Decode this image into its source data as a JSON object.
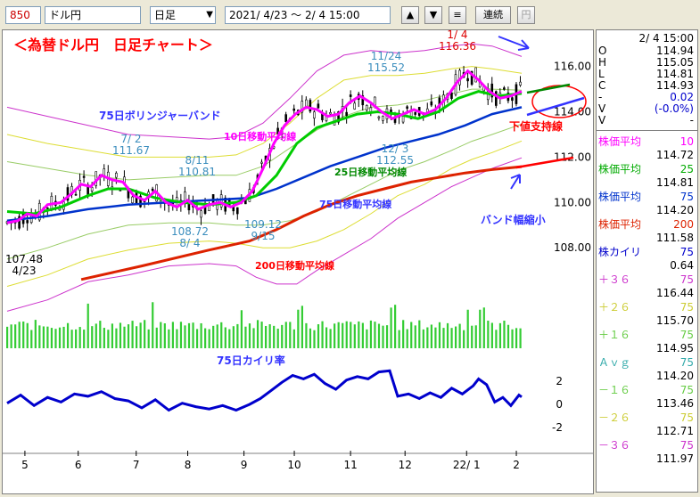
{
  "toolbar": {
    "code": "850",
    "symbol": "ドル円",
    "period": "日足",
    "dropdown_arrow": "▼",
    "range": "2021/ 4/23 〜  2/ 4 15:00",
    "up_btn": "▲",
    "down_btn": "▼",
    "menu_btn": "≡",
    "renzoku": "連続",
    "yen": "円"
  },
  "colors": {
    "candle": "#000000",
    "ma10": "#ff00ff",
    "ma25": "#00cc00",
    "ma75": "#0033cc",
    "ma200": "#dd2200",
    "bb1": "#99cc66",
    "bb2": "#dddd33",
    "bb3": "#cc33cc",
    "kairi": "#0000cc",
    "volume": "#33cc33",
    "annotation_red": "#ff0000",
    "annotation_blue": "#3333ff",
    "annotation_magenta": "#ff00ff",
    "annotation_green": "#008800"
  },
  "annotations": {
    "title": "＜為替ドル円　日足チャート＞",
    "bollinger": "75日ボリンジャーバンド",
    "ma10": "10日移動平均線",
    "ma25": "25日移動平均線",
    "ma75": "75日移動平均線",
    "ma200": "200日移動平均線",
    "support": "下値支持線",
    "band_shrink": "バンド幅縮小",
    "kairi_label": "75日カイリ率"
  },
  "chart_data": {
    "type": "line",
    "price_axis": {
      "ticks": [
        "116.00",
        "114.00",
        "112.00",
        "110.00",
        "108.00"
      ],
      "ylim": [
        106.2,
        117.4
      ]
    },
    "kairi_axis": {
      "ticks": [
        "2",
        "0",
        "-2"
      ]
    },
    "x_ticks": [
      "5",
      "6",
      "7",
      "8",
      "9",
      "10",
      "11",
      "12",
      "22/ 1",
      "2"
    ],
    "callouts": [
      {
        "date": "1/ 4",
        "value": "116.36"
      },
      {
        "date": "11/24",
        "value": "115.52"
      },
      {
        "date": "7/ 2",
        "value": "111.67"
      },
      {
        "date": "8/11",
        "value": "110.81"
      },
      {
        "date": "12/ 3",
        "value": "112.55"
      },
      {
        "date": "8/ 4",
        "value": "108.72"
      },
      {
        "date": "9/15",
        "value": "109.12"
      },
      {
        "date": "4/23",
        "value": "107.48"
      }
    ],
    "series_points": {
      "ma10": [
        [
          0,
          109.1
        ],
        [
          8,
          109.2
        ],
        [
          15,
          109.5
        ],
        [
          22,
          109.4
        ],
        [
          30,
          109.9
        ],
        [
          40,
          110.0
        ],
        [
          48,
          110.4
        ],
        [
          55,
          110.8
        ],
        [
          62,
          110.7
        ],
        [
          70,
          111.2
        ],
        [
          78,
          111.0
        ],
        [
          86,
          110.9
        ],
        [
          94,
          110.3
        ],
        [
          102,
          110.1
        ],
        [
          110,
          110.5
        ],
        [
          118,
          110.0
        ],
        [
          126,
          109.8
        ],
        [
          134,
          110.1
        ],
        [
          142,
          109.7
        ],
        [
          150,
          109.9
        ],
        [
          158,
          110.0
        ],
        [
          166,
          109.8
        ],
        [
          174,
          110.0
        ],
        [
          182,
          110.5
        ],
        [
          190,
          111.5
        ],
        [
          198,
          112.6
        ],
        [
          206,
          113.4
        ],
        [
          214,
          113.9
        ],
        [
          222,
          114.2
        ],
        [
          230,
          114.1
        ],
        [
          238,
          113.8
        ],
        [
          246,
          113.9
        ],
        [
          254,
          114.4
        ],
        [
          262,
          114.7
        ],
        [
          270,
          114.4
        ],
        [
          278,
          114.0
        ],
        [
          286,
          113.7
        ],
        [
          294,
          113.9
        ],
        [
          302,
          114.1
        ],
        [
          310,
          113.9
        ],
        [
          318,
          114.1
        ],
        [
          326,
          114.6
        ],
        [
          334,
          115.3
        ],
        [
          342,
          115.8
        ],
        [
          350,
          115.4
        ],
        [
          358,
          114.9
        ],
        [
          366,
          114.6
        ],
        [
          374,
          114.7
        ],
        [
          382,
          114.9
        ]
      ],
      "ma25": [
        [
          0,
          109.6
        ],
        [
          20,
          109.5
        ],
        [
          40,
          109.8
        ],
        [
          60,
          110.3
        ],
        [
          75,
          110.6
        ],
        [
          90,
          110.6
        ],
        [
          110,
          110.2
        ],
        [
          130,
          110.0
        ],
        [
          150,
          109.9
        ],
        [
          170,
          110.0
        ],
        [
          185,
          110.3
        ],
        [
          200,
          111.2
        ],
        [
          215,
          112.6
        ],
        [
          230,
          113.3
        ],
        [
          245,
          113.6
        ],
        [
          260,
          113.9
        ],
        [
          275,
          114.0
        ],
        [
          290,
          113.9
        ],
        [
          305,
          113.7
        ],
        [
          320,
          114.0
        ],
        [
          335,
          114.6
        ],
        [
          350,
          114.9
        ],
        [
          365,
          114.7
        ],
        [
          382,
          114.81
        ]
      ],
      "ma75": [
        [
          0,
          109.2
        ],
        [
          30,
          109.4
        ],
        [
          60,
          109.7
        ],
        [
          90,
          109.9
        ],
        [
          120,
          110.0
        ],
        [
          150,
          110.1
        ],
        [
          180,
          110.2
        ],
        [
          200,
          110.6
        ],
        [
          220,
          111.1
        ],
        [
          240,
          111.6
        ],
        [
          260,
          112.0
        ],
        [
          280,
          112.4
        ],
        [
          300,
          112.7
        ],
        [
          320,
          113.0
        ],
        [
          340,
          113.4
        ],
        [
          360,
          113.9
        ],
        [
          382,
          114.2
        ]
      ],
      "ma200": [
        [
          55,
          106.6
        ],
        [
          100,
          107.2
        ],
        [
          150,
          107.9
        ],
        [
          180,
          108.3
        ],
        [
          200,
          108.8
        ],
        [
          220,
          109.4
        ],
        [
          240,
          109.9
        ],
        [
          260,
          110.3
        ],
        [
          280,
          110.6
        ],
        [
          300,
          110.9
        ],
        [
          320,
          111.1
        ],
        [
          340,
          111.3
        ],
        [
          360,
          111.45
        ],
        [
          382,
          111.58
        ]
      ],
      "bb_plus3": [
        [
          0,
          114.2
        ],
        [
          30,
          113.8
        ],
        [
          60,
          113.4
        ],
        [
          90,
          113.0
        ],
        [
          120,
          112.9
        ],
        [
          150,
          112.8
        ],
        [
          170,
          112.9
        ],
        [
          190,
          113.5
        ],
        [
          210,
          114.6
        ],
        [
          230,
          115.8
        ],
        [
          250,
          116.5
        ],
        [
          270,
          116.7
        ],
        [
          290,
          116.6
        ],
        [
          310,
          116.7
        ],
        [
          330,
          116.9
        ],
        [
          345,
          117.0
        ],
        [
          360,
          116.9
        ],
        [
          382,
          116.44
        ]
      ],
      "bb_plus2": [
        [
          0,
          113.0
        ],
        [
          30,
          112.6
        ],
        [
          60,
          112.3
        ],
        [
          90,
          112.0
        ],
        [
          120,
          112.0
        ],
        [
          150,
          112.0
        ],
        [
          170,
          112.1
        ],
        [
          190,
          112.6
        ],
        [
          210,
          113.5
        ],
        [
          230,
          114.6
        ],
        [
          250,
          115.4
        ],
        [
          270,
          115.6
        ],
        [
          290,
          115.6
        ],
        [
          310,
          115.7
        ],
        [
          330,
          115.9
        ],
        [
          345,
          116.0
        ],
        [
          360,
          115.9
        ],
        [
          382,
          115.7
        ]
      ],
      "bb_plus1": [
        [
          0,
          111.8
        ],
        [
          30,
          111.5
        ],
        [
          60,
          111.2
        ],
        [
          90,
          111.0
        ],
        [
          120,
          111.1
        ],
        [
          150,
          111.2
        ],
        [
          170,
          111.2
        ],
        [
          190,
          111.6
        ],
        [
          210,
          112.4
        ],
        [
          230,
          113.2
        ],
        [
          250,
          113.8
        ],
        [
          270,
          114.2
        ],
        [
          290,
          114.3
        ],
        [
          310,
          114.5
        ],
        [
          330,
          114.8
        ],
        [
          345,
          115.0
        ],
        [
          360,
          115.0
        ],
        [
          382,
          114.95
        ]
      ],
      "bb_minus1": [
        [
          0,
          107.5
        ],
        [
          30,
          108.0
        ],
        [
          60,
          108.6
        ],
        [
          90,
          109.0
        ],
        [
          120,
          109.1
        ],
        [
          150,
          109.1
        ],
        [
          170,
          109.0
        ],
        [
          190,
          109.0
        ],
        [
          210,
          109.2
        ],
        [
          230,
          109.6
        ],
        [
          250,
          110.2
        ],
        [
          270,
          110.8
        ],
        [
          290,
          111.4
        ],
        [
          310,
          111.8
        ],
        [
          330,
          112.3
        ],
        [
          345,
          112.7
        ],
        [
          360,
          113.0
        ],
        [
          382,
          113.46
        ]
      ],
      "bb_minus2": [
        [
          0,
          106.3
        ],
        [
          30,
          106.8
        ],
        [
          60,
          107.5
        ],
        [
          90,
          107.9
        ],
        [
          120,
          108.2
        ],
        [
          150,
          108.3
        ],
        [
          170,
          108.2
        ],
        [
          190,
          108.0
        ],
        [
          210,
          108.0
        ],
        [
          230,
          108.3
        ],
        [
          250,
          108.8
        ],
        [
          270,
          109.5
        ],
        [
          290,
          110.3
        ],
        [
          310,
          110.8
        ],
        [
          330,
          111.5
        ],
        [
          345,
          111.9
        ],
        [
          360,
          112.2
        ],
        [
          382,
          112.71
        ]
      ],
      "bb_minus3": [
        [
          0,
          105.2
        ],
        [
          30,
          105.7
        ],
        [
          60,
          106.5
        ],
        [
          90,
          106.8
        ],
        [
          120,
          107.2
        ],
        [
          150,
          107.3
        ],
        [
          170,
          107.2
        ],
        [
          185,
          106.7
        ],
        [
          200,
          106.4
        ],
        [
          215,
          106.4
        ],
        [
          230,
          107.0
        ],
        [
          250,
          107.7
        ],
        [
          270,
          108.4
        ],
        [
          290,
          109.3
        ],
        [
          310,
          110.0
        ],
        [
          330,
          110.7
        ],
        [
          345,
          111.1
        ],
        [
          360,
          111.5
        ],
        [
          382,
          111.97
        ]
      ],
      "kairi": [
        [
          0,
          0.1
        ],
        [
          10,
          0.8
        ],
        [
          20,
          -0.1
        ],
        [
          30,
          0.6
        ],
        [
          40,
          0.2
        ],
        [
          50,
          0.9
        ],
        [
          60,
          0.7
        ],
        [
          70,
          1.1
        ],
        [
          80,
          0.5
        ],
        [
          90,
          0.3
        ],
        [
          100,
          -0.3
        ],
        [
          110,
          0.4
        ],
        [
          120,
          -0.5
        ],
        [
          130,
          0.1
        ],
        [
          140,
          -0.2
        ],
        [
          150,
          -0.4
        ],
        [
          160,
          -0.1
        ],
        [
          170,
          -0.5
        ],
        [
          180,
          0.0
        ],
        [
          188,
          0.5
        ],
        [
          196,
          1.2
        ],
        [
          204,
          1.9
        ],
        [
          212,
          2.5
        ],
        [
          220,
          2.2
        ],
        [
          228,
          2.6
        ],
        [
          236,
          1.8
        ],
        [
          244,
          1.3
        ],
        [
          252,
          2.1
        ],
        [
          260,
          2.4
        ],
        [
          268,
          2.2
        ],
        [
          276,
          2.8
        ],
        [
          284,
          2.9
        ],
        [
          290,
          0.7
        ],
        [
          298,
          0.9
        ],
        [
          306,
          0.5
        ],
        [
          314,
          1.0
        ],
        [
          322,
          0.6
        ],
        [
          330,
          1.4
        ],
        [
          338,
          0.9
        ],
        [
          346,
          1.6
        ],
        [
          350,
          2.2
        ],
        [
          356,
          1.7
        ],
        [
          362,
          0.2
        ],
        [
          368,
          0.6
        ],
        [
          374,
          -0.1
        ],
        [
          380,
          0.8
        ],
        [
          382,
          0.64
        ]
      ]
    }
  },
  "panel": {
    "datetime": "2/ 4 15:00",
    "ohlc": [
      {
        "k": "O",
        "v": "114.94"
      },
      {
        "k": "H",
        "v": "115.05"
      },
      {
        "k": "L",
        "v": "114.81"
      },
      {
        "k": "C",
        "v": "114.93"
      },
      {
        "k": "-",
        "v": "0.02"
      },
      {
        "k": "V",
        "v": "(-0.0%)"
      },
      {
        "k": "V",
        "v": "-"
      }
    ],
    "indicators": [
      {
        "name": "株価平均",
        "period": "10",
        "value": "114.72",
        "color": "#ff00ff"
      },
      {
        "name": "株価平均",
        "period": "25",
        "value": "114.81",
        "color": "#00aa00"
      },
      {
        "name": "株価平均",
        "period": "75",
        "value": "114.20",
        "color": "#0033cc"
      },
      {
        "name": "株価平均",
        "period": "200",
        "value": "111.58",
        "color": "#dd2200"
      },
      {
        "name": "株カイリ",
        "period": "75",
        "value": "0.64",
        "color": "#0000cc"
      },
      {
        "name": "＋３６",
        "period": "75",
        "value": "116.44",
        "color": "#cc33cc"
      },
      {
        "name": "＋２６",
        "period": "75",
        "value": "115.70",
        "color": "#cccc33"
      },
      {
        "name": "＋１６",
        "period": "75",
        "value": "114.95",
        "color": "#66cc44"
      },
      {
        "name": "Ａｖｇ",
        "period": "75",
        "value": "114.20",
        "color": "#33aaaa"
      },
      {
        "name": "－１６",
        "period": "75",
        "value": "113.46",
        "color": "#66cc44"
      },
      {
        "name": "－２６",
        "period": "75",
        "value": "112.71",
        "color": "#cccc33"
      },
      {
        "name": "－３６",
        "period": "75",
        "value": "111.97",
        "color": "#cc33cc"
      }
    ]
  }
}
